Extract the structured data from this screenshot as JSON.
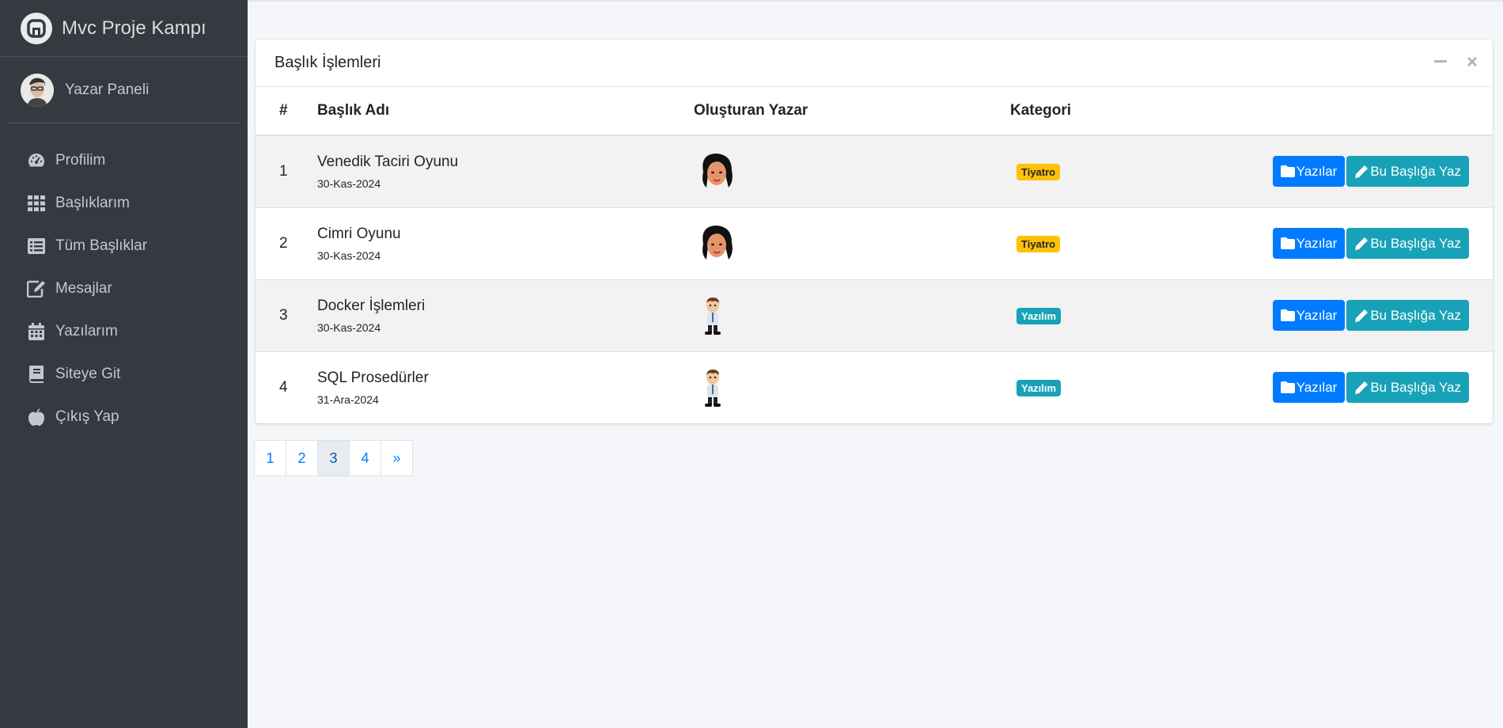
{
  "brand": {
    "name": "Mvc Proje Kampı"
  },
  "user": {
    "name": "Yazar Paneli"
  },
  "sidebar": {
    "items": [
      {
        "label": "Profilim",
        "icon": "dashboard-gauge-icon"
      },
      {
        "label": "Başlıklarım",
        "icon": "grid-icon"
      },
      {
        "label": "Tüm Başlıklar",
        "icon": "list-icon"
      },
      {
        "label": "Mesajlar",
        "icon": "edit-icon"
      },
      {
        "label": "Yazılarım",
        "icon": "calendar-icon"
      },
      {
        "label": "Siteye Git",
        "icon": "book-icon"
      },
      {
        "label": "Çıkış Yap",
        "icon": "apple-icon"
      }
    ]
  },
  "card": {
    "title": "Başlık İşlemleri",
    "tools": [
      "minimize-icon",
      "close-icon"
    ]
  },
  "table": {
    "headers": [
      "#",
      "Başlık Adı",
      "Oluşturan Yazar",
      "Kategori",
      ""
    ],
    "rows": [
      {
        "num": "1",
        "title": "Venedik Taciri Oyunu",
        "date": "30-Kas-2024",
        "author_icon": "woman-avatar-icon",
        "category": "Tiyatro",
        "category_color": "#ffc107"
      },
      {
        "num": "2",
        "title": "Cimri Oyunu",
        "date": "30-Kas-2024",
        "author_icon": "woman-avatar-icon",
        "category": "Tiyatro",
        "category_color": "#ffc107"
      },
      {
        "num": "3",
        "title": "Docker İşlemleri",
        "date": "30-Kas-2024",
        "author_icon": "man-cartoon-avatar-icon",
        "category": "Yazılım",
        "category_color": "#17a2b8"
      },
      {
        "num": "4",
        "title": "SQL Prosedürler",
        "date": "31-Ara-2024",
        "author_icon": "man-cartoon-avatar-icon",
        "category": "Yazılım",
        "category_color": "#17a2b8"
      }
    ],
    "actions": {
      "posts_label": "Yazılar",
      "write_label": "Bu Başlığa Yaz"
    }
  },
  "pagination": {
    "pages": [
      "1",
      "2",
      "3",
      "4",
      "»"
    ],
    "active": "3"
  },
  "colors": {
    "primary": "#007bff",
    "info": "#17a2b8",
    "warning": "#ffc107",
    "sidebar": "#343a40"
  }
}
